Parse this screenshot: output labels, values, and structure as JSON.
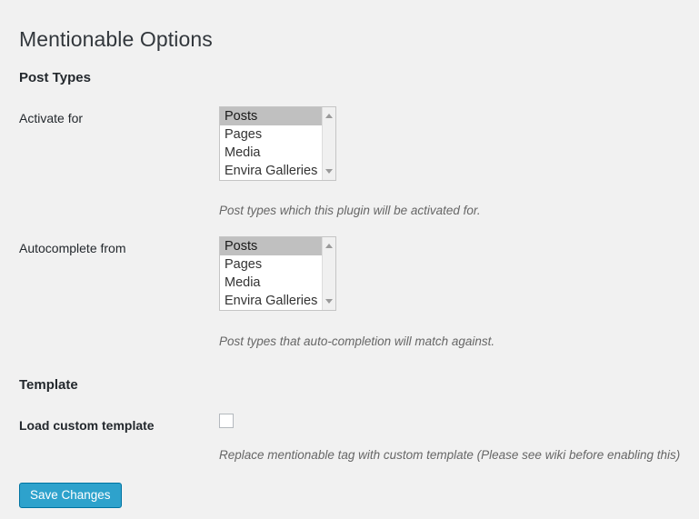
{
  "page": {
    "title": "Mentionable Options"
  },
  "sections": {
    "post_types": {
      "heading": "Post Types",
      "fields": {
        "activate_for": {
          "label": "Activate for",
          "help": "Post types which this plugin will be activated for.",
          "options": [
            "Posts",
            "Pages",
            "Media",
            "Envira Galleries"
          ],
          "selected": "Posts",
          "scroll_up_icon": "triangle-up-icon",
          "scroll_down_icon": "triangle-down-icon"
        },
        "autocomplete_from": {
          "label": "Autocomplete from",
          "help": "Post types that auto-completion will match against.",
          "options": [
            "Posts",
            "Pages",
            "Media",
            "Envira Galleries"
          ],
          "selected": "Posts",
          "scroll_up_icon": "triangle-up-icon",
          "scroll_down_icon": "triangle-down-icon"
        }
      }
    },
    "template": {
      "heading": "Template",
      "fields": {
        "load_custom_template": {
          "label": "Load custom template",
          "help": "Replace mentionable tag with custom template (Please see wiki before enabling this)",
          "checked": false
        }
      }
    }
  },
  "actions": {
    "save_label": "Save Changes"
  },
  "colors": {
    "page_background": "#f1f1f1",
    "button_background": "#2ea2cc",
    "button_border": "#0074a2",
    "button_text": "#ffffff",
    "selected_option_background": "#c0c0c0",
    "help_text": "#666666",
    "heading_text": "#23282d",
    "title_text": "#32373c"
  }
}
